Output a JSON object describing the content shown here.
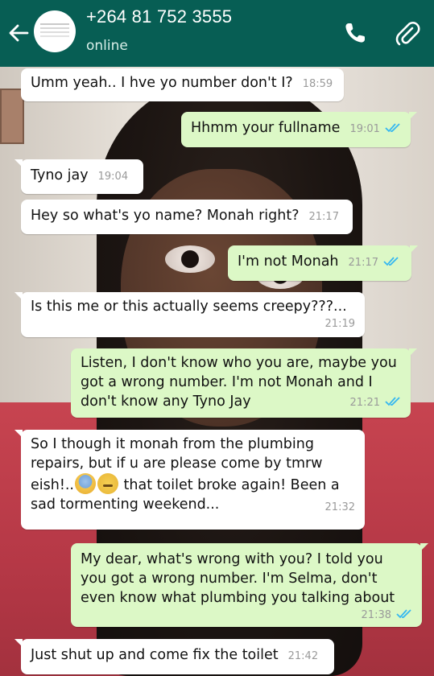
{
  "header": {
    "contact": "+264 81 752 3555",
    "status": "online"
  },
  "messages": [
    {
      "dir": "in",
      "text": "Umm yeah.. I hve yo number don't I?",
      "time": "18:59"
    },
    {
      "dir": "out",
      "text": "Hhmm your fullname",
      "time": "19:01"
    },
    {
      "dir": "in",
      "text": "Tyno jay",
      "time": "19:04"
    },
    {
      "dir": "in",
      "text": "Hey so what's yo name? Monah right?",
      "time": "21:17"
    },
    {
      "dir": "out",
      "text": "I'm not Monah",
      "time": "21:17"
    },
    {
      "dir": "in",
      "text": "Is this me or this actually seems creepy???...",
      "time": "21:19"
    },
    {
      "dir": "out",
      "text": "Listen, I don't know who you are, maybe you\ngot a wrong number. I'm not Monah and I\ndon't know any Tyno Jay",
      "time": "21:21"
    },
    {
      "dir": "in",
      "text_a": "So I though it monah from the plumbing\nrepairs, but if u are please come by tmrw\neish!..",
      "emojis": [
        "fearful-face",
        "sad-relieved-face"
      ],
      "text_b": " that toilet broke again! Been a\nsad tormenting weekend...",
      "time": "21:32"
    },
    {
      "dir": "out",
      "text": "My dear, what's wrong with you? I told you\nyou got a wrong number. I'm Selma, don't\neven know what plumbing you talking about",
      "time": "21:38"
    },
    {
      "dir": "in",
      "text": "Just shut up and come fix the toilet",
      "time": "21:42"
    }
  ],
  "colors": {
    "header": "#075e54",
    "bubble_in": "#ffffff",
    "bubble_out": "#dcf8c6",
    "read_ticks": "#34b7f1"
  },
  "icons": [
    "back-arrow-icon",
    "profile-avatar",
    "call-icon",
    "attach-icon",
    "double-check-icon"
  ]
}
